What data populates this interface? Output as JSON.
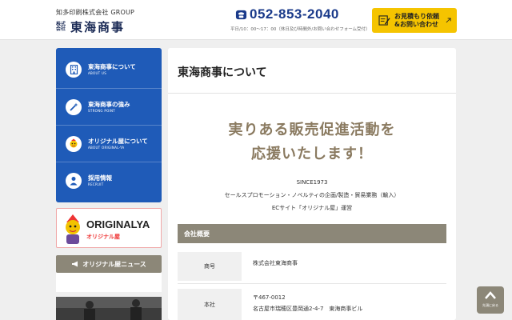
{
  "header": {
    "group": "知多印刷株式会社 GROUP",
    "kabushiki": "株式会社",
    "name": "東海商事",
    "tel": "052-853-2040",
    "hours": "平日/10：00〜17：00（休日及び時間外/お問い合わせフォーム受付）",
    "contact_label_1": "お見積もり依頼",
    "contact_label_2": "&お問い合わせ",
    "accent": "#f5c400"
  },
  "sidebar": {
    "items": [
      {
        "ja": "東海商事について",
        "en": "ABOUT US",
        "icon": "building-icon"
      },
      {
        "ja": "東海商事の強み",
        "en": "STRONG POINT",
        "icon": "wand-icon"
      },
      {
        "ja": "オリジナル屋について",
        "en": "ABOUT ORIGINAL-YA",
        "icon": "mascot-icon"
      },
      {
        "ja": "採用情報",
        "en": "RECRUIT",
        "icon": "person-icon"
      }
    ],
    "banner_brand": "ORIGINALYA",
    "banner_sub": "オリジナル屋",
    "news_label": "オリジナル屋ニュース",
    "nav_color": "#1f5bb8"
  },
  "main": {
    "title": "東海商事について",
    "catch_line1": "実りある販売促進活動を",
    "catch_line2": "応援いたします！",
    "intro_line1": "SINCE1973",
    "intro_line2": "セールスプロモーション・ノベルティの企画/製造・貿易業務（輸入）",
    "intro_line3": "ECサイト「オリジナル屋」運営",
    "profile_heading": "会社概要",
    "profile": [
      {
        "label": "商号",
        "value1": "株式会社東海商事",
        "value2": ""
      },
      {
        "label": "本社",
        "value1": "〒467-0012",
        "value2": "名古屋市瑞穂区豊岡通2-4-7　東海商事ビル"
      }
    ],
    "catch_color": "#8a7a60"
  },
  "pagetop_label": "先頭に戻る"
}
